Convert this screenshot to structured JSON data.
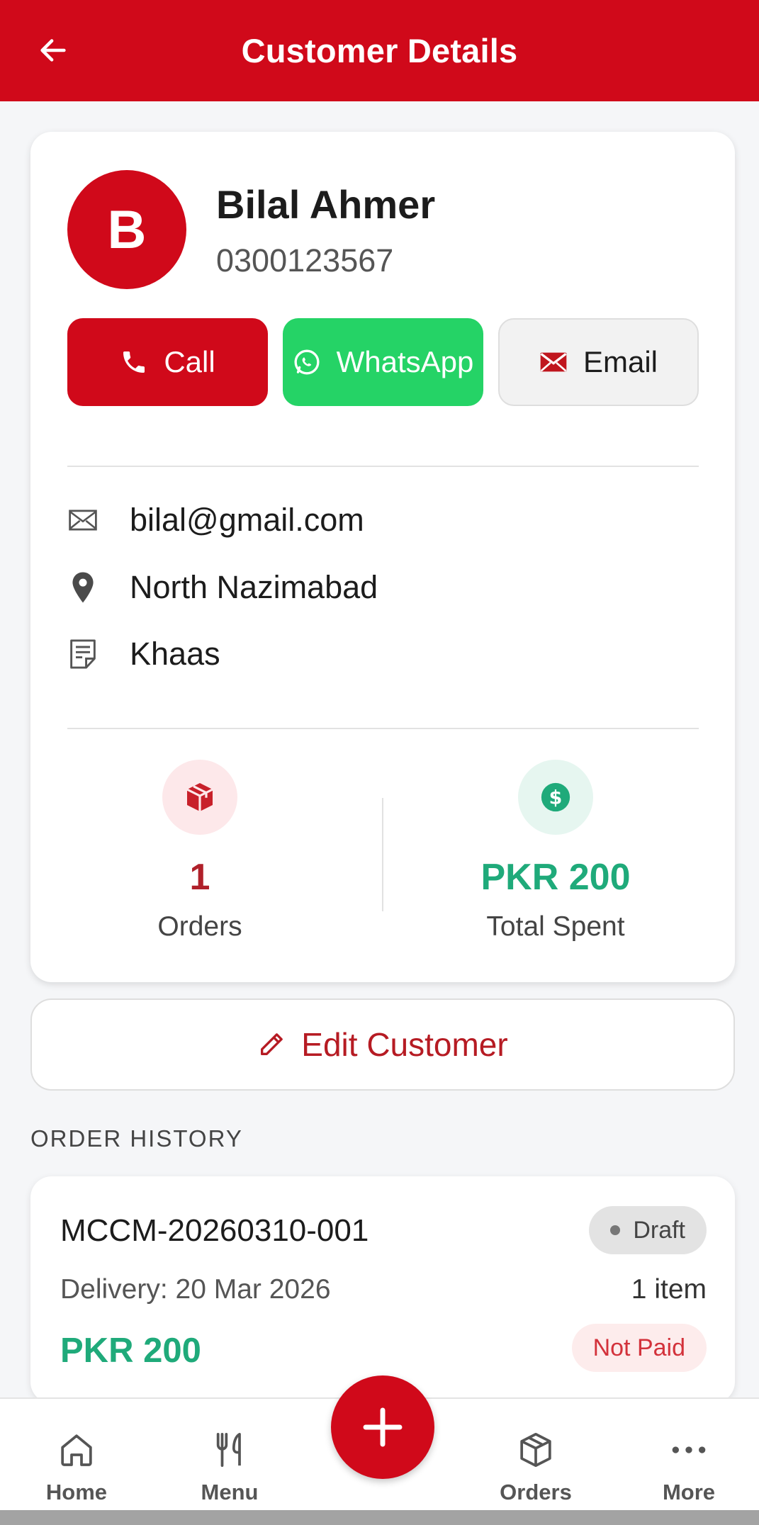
{
  "header": {
    "title": "Customer Details"
  },
  "customer": {
    "initial": "B",
    "name": "Bilal Ahmer",
    "phone": "0300123567",
    "email": "bilal@gmail.com",
    "address": "North Nazimabad",
    "note": "Khaas"
  },
  "actions": {
    "call": "Call",
    "whatsapp": "WhatsApp",
    "email": "Email"
  },
  "stats": {
    "orders_value": "1",
    "orders_label": "Orders",
    "spent_value": "PKR 200",
    "spent_label": "Total Spent"
  },
  "edit_button": "Edit Customer",
  "order_history": {
    "title": "ORDER HISTORY",
    "orders": [
      {
        "id": "MCCM-20260310-001",
        "status": "Draft",
        "delivery": "Delivery: 20 Mar 2026",
        "items": "1 item",
        "amount": "PKR 200",
        "payment": "Not Paid"
      }
    ]
  },
  "nav": {
    "home": "Home",
    "menu": "Menu",
    "orders": "Orders",
    "more": "More"
  },
  "colors": {
    "brand": "#d0091a",
    "whatsapp": "#25d366",
    "money": "#1faa7a"
  }
}
